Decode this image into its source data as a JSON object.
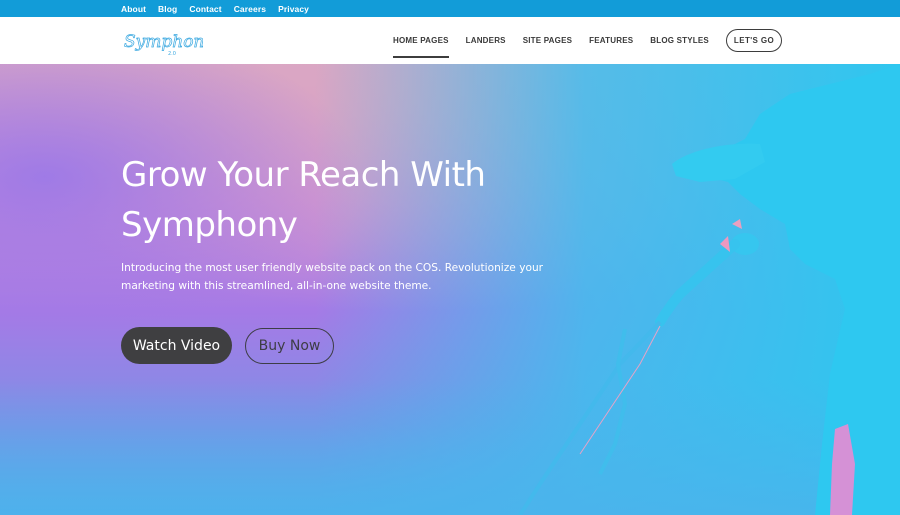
{
  "topbar": {
    "links": [
      "About",
      "Blog",
      "Contact",
      "Careers",
      "Privacy"
    ],
    "color": "#129cd8"
  },
  "header": {
    "logo": {
      "text": "Symphony",
      "version": "2.0",
      "color": "#3aa8e0"
    },
    "nav": [
      {
        "label": "HOME PAGES",
        "active": true
      },
      {
        "label": "LANDERS",
        "active": false
      },
      {
        "label": "SITE PAGES",
        "active": false
      },
      {
        "label": "FEATURES",
        "active": false
      },
      {
        "label": "BLOG STYLES",
        "active": false
      }
    ],
    "cta_label": "LET'S GO"
  },
  "hero": {
    "title_line1": "Grow Your Reach With",
    "title_line2": "Symphony",
    "subtitle": "Introducing the most user friendly website pack on the COS. Revolutionize your marketing with this streamlined, all-in-one website theme.",
    "primary_button": "Watch Video",
    "secondary_button": "Buy Now",
    "image_description": "singer-with-microphone-duotone",
    "colors": {
      "pink": "#d9a6c6",
      "purple": "#a57ae6",
      "cyan": "#2ec7ee",
      "button_dark": "#3f3f41"
    }
  }
}
